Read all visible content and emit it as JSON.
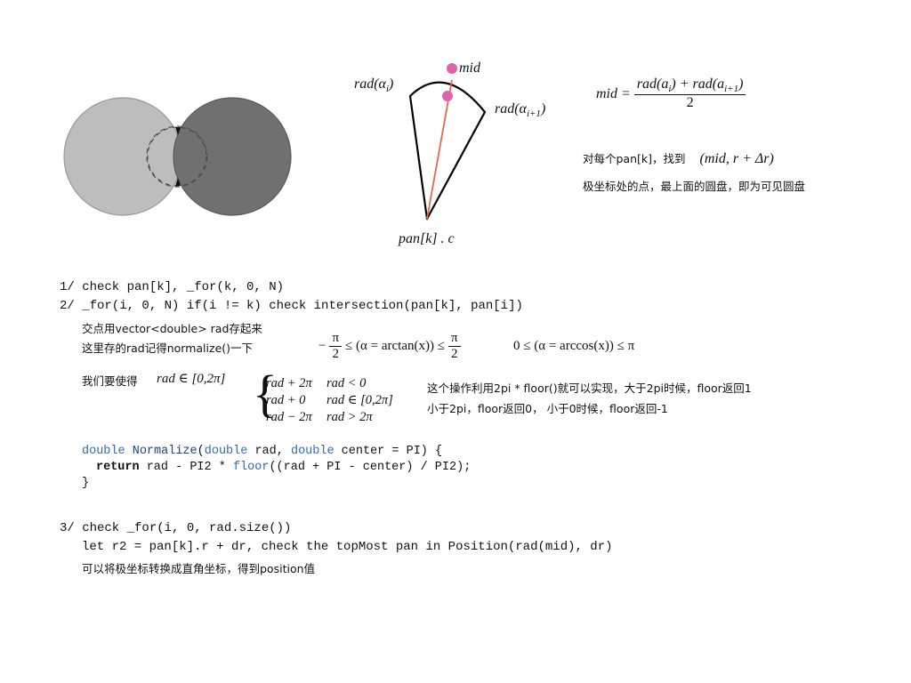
{
  "diagram": {
    "label_rad_ai": "rad(α",
    "label_rad_ai_sub": "i",
    "label_rad_ai1": "rad(α",
    "label_rad_ai1_sub": "i+1",
    "label_mid": "mid",
    "label_center": "pan[k] . c",
    "colors": {
      "left_disk": "#bdbdbd",
      "right_disk": "#707070",
      "mid_dot": "#de63a8",
      "mid_line": "#e8684a"
    }
  },
  "formula_mid": {
    "lhs": "mid =",
    "numerator": "rad(a",
    "num_sub1": "i",
    "num_mid": ") + rad(a",
    "num_sub2": "i+1",
    "num_end": ")",
    "denominator": "2"
  },
  "note": {
    "line1_text": "对每个pan[k]，找到",
    "line1_math": "(mid, r + Δr)",
    "line2": "极坐标处的点，最上面的圆盘，即为可见圆盘"
  },
  "steps": {
    "s1": "1/ check pan[k], _for(k, 0, N)",
    "s2": "2/ _for(i, 0, N) if(i != k) check intersection(pan[k], pan[i])",
    "s2_note1": "交点用vector<double> rad存起来",
    "s2_note2": "这里存的rad记得normalize()一下",
    "arctan_left": "−",
    "arctan_pi": "π",
    "arctan_2": "2",
    "arctan_mid": "≤ (α = arctan(x)) ≤",
    "arccos": "0 ≤ (α = arccos(x)) ≤ π",
    "goal_text": "我们要使得",
    "goal_math": "rad ∈ [0,2π]",
    "cases": [
      {
        "expr": "rad + 2π",
        "cond": "rad < 0"
      },
      {
        "expr": "rad + 0",
        "cond": "rad ∈ [0,2π]"
      },
      {
        "expr": "rad − 2π",
        "cond": "rad > 2π"
      }
    ],
    "floor_note1": "这个操作利用2pi * floor()就可以实现，大于2pi时候，floor返回1",
    "floor_note2": "小于2pi，floor返回0，  小于0时候，floor返回-1",
    "code": {
      "kw_double": "double",
      "fn_name": "Normalize",
      "l1_a": "(",
      "l1_b": " rad, ",
      "l1_c": " center = PI) {",
      "kw_return": "return",
      "l2_a": " rad - PI2 * ",
      "fn_floor": "floor",
      "l2_b": "((rad + PI - center) / PI2);",
      "l3": "}"
    },
    "s3": "3/ check _for(i, 0, rad.size())",
    "s3_line2": "let r2 = pan[k].r + dr, check the topMost pan in Position(rad(mid), dr)",
    "s3_note": "可以将极坐标转换成直角坐标，得到position值"
  }
}
